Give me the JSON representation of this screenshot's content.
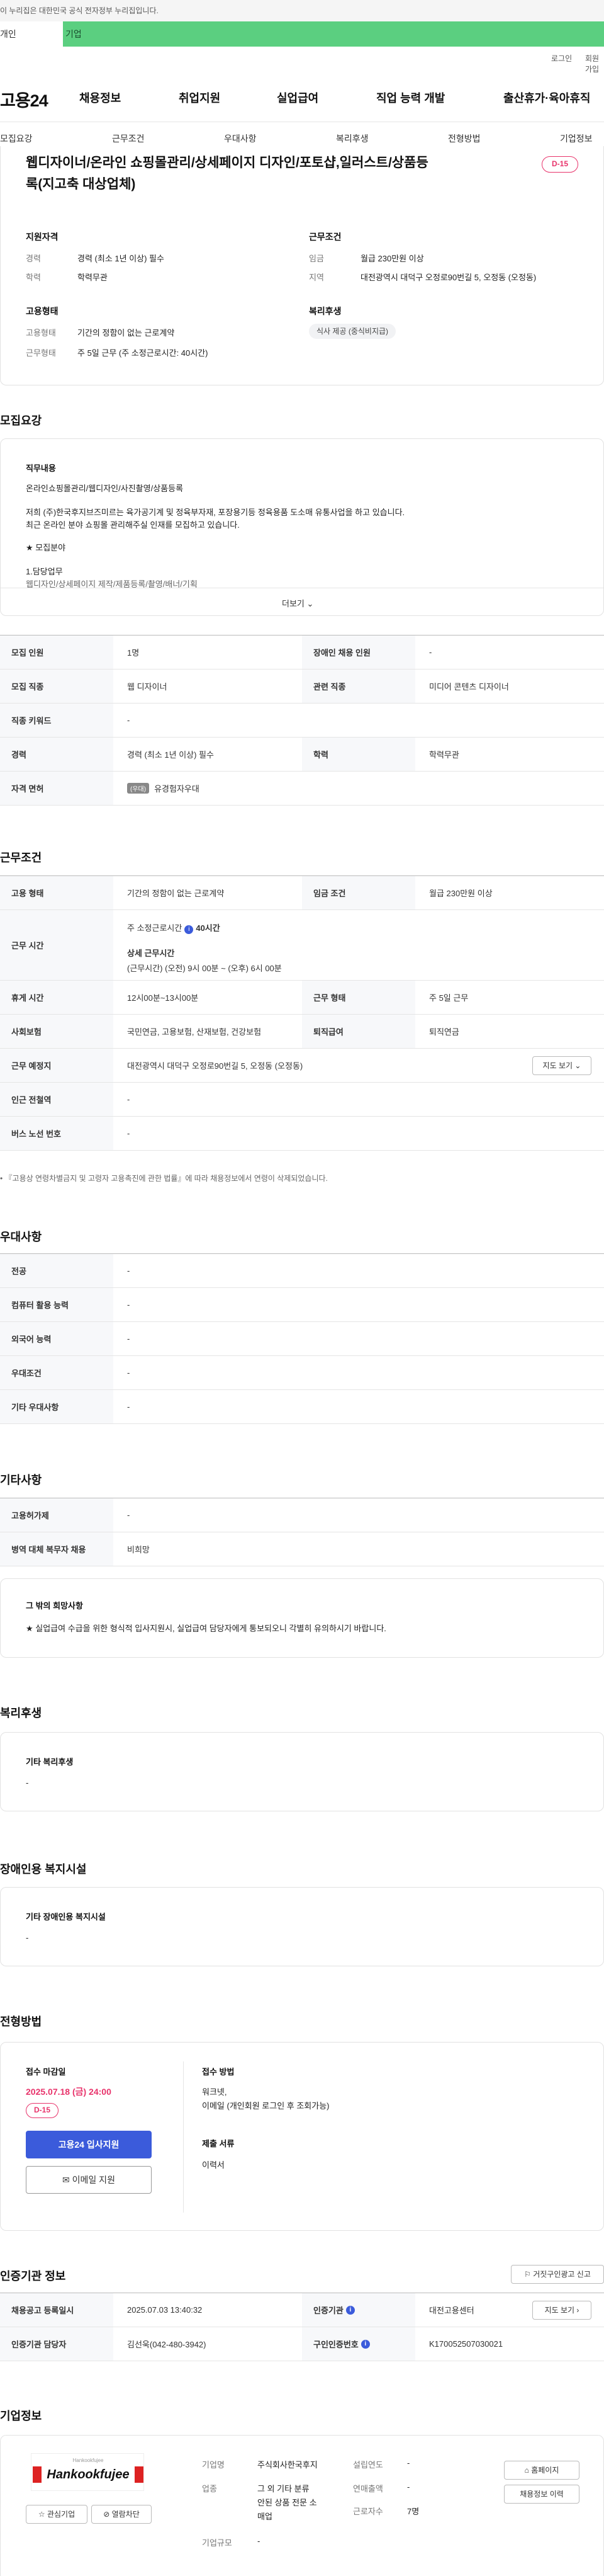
{
  "gov_banner": "이 누리집은 대한민국 공식 전자정부 누리집입니다.",
  "user_tabs": [
    "개인",
    "기업"
  ],
  "util": {
    "login": "로그인",
    "join": "회원가입"
  },
  "logo": "고용24",
  "gnb": [
    "채용정보",
    "취업지원",
    "실업급여",
    "직업 능력 개발",
    "출산휴가·육아휴직"
  ],
  "subnav": [
    "모집요강",
    "근무조건",
    "우대사항",
    "복리후생",
    "전형방법",
    "기업정보"
  ],
  "summary": {
    "title_line1": "웹디자이너/온라인 쇼핑몰관리/상세페이지 디자인/포토샵,일러스트/상품등",
    "title_line2": "록(지고축 대상업체)",
    "dday": "D-15",
    "qual_title": "지원자격",
    "qual": [
      {
        "k": "경력",
        "v": "경력 (최소 1년 이상) 필수"
      },
      {
        "k": "학력",
        "v": "학력무관"
      }
    ],
    "cond_title": "근무조건",
    "cond": [
      {
        "k": "임금",
        "v": "월급 230만원 이상"
      },
      {
        "k": "지역",
        "v": "대전광역시 대덕구 오정로90번길 5, 오정동 (오정동)"
      }
    ],
    "emp_title": "고용형태",
    "emp": [
      {
        "k": "고용형태",
        "v": "기간의 정함이 없는 근로계약"
      },
      {
        "k": "근무형태",
        "v": "주 5일 근무 (주 소정근로시간: 40시간)"
      }
    ],
    "welfare_title": "복리후생",
    "welfare_chip": "식사 제공 (중식비지급)"
  },
  "recruit": {
    "title": "모집요강",
    "duty_title": "직무내용",
    "duty_line1": "온라인쇼핑몰관리/웹디자인/사진촬영/상품등록",
    "duty_line2": "저희 (주)한국후지브즈미르는 육가공기계 및 정육부자재, 포장용기등 정육용품 도소매 유통사업을 하고 있습니다.",
    "duty_line3": "최근 온라인 분야  쇼핑몰 관리해주실 인재를 모집하고 있습니다.",
    "duty_line4": "★ 모집분야",
    "duty_line5": "1.담당업무",
    "duty_line6": "웹디자인/상세페이지 제작/제품등록/촬영/배너/기획",
    "more": "더보기",
    "rows": [
      {
        "k1": "모집 인원",
        "v1": "1명",
        "k2": "장애인 채용 인원",
        "v2": "-"
      },
      {
        "k1": "모집 직종",
        "v1": "웹 디자이너",
        "k2": "관련 직종",
        "v2": "미디어 콘텐츠 디자이너"
      },
      {
        "k1": "직종 키워드",
        "v1": "-"
      },
      {
        "k1": "경력",
        "v1": "경력 (최소 1년 이상) 필수",
        "k2": "학력",
        "v2": "학력무관"
      },
      {
        "k1": "자격 면허",
        "tag": "(우대)",
        "v1": "유경험자우대"
      }
    ]
  },
  "work": {
    "title": "근무조건",
    "r1": {
      "k1": "고용 형태",
      "v1": "기간의 정함이 없는 근로계약",
      "k2": "임금 조건",
      "v2": "월급 230만원 이상"
    },
    "r2": {
      "k": "근무 시간",
      "hours": "주 소정근로시간",
      "hours_v": "40시간",
      "detail_title": "상세 근무시간",
      "detail": "(근무시간) (오전) 9시 00분 ~ (오후) 6시 00분"
    },
    "r3": {
      "k1": "휴게 시간",
      "v1": "12시00분~13시00분",
      "k2": "근무 형태",
      "v2": "주 5일 근무"
    },
    "r4": {
      "k1": "사회보험",
      "v1": "국민연금, 고용보험, 산재보험, 건강보험",
      "k2": "퇴직급여",
      "v2": "퇴직연금"
    },
    "r5": {
      "k": "근무 예정지",
      "v": "대전광역시 대덕구 오정로90번길 5, 오정동 (오정동)",
      "btn": "지도 보기"
    },
    "r6": {
      "k": "인근 전철역",
      "v": "-"
    },
    "r7": {
      "k": "버스 노선 번호",
      "v": "-"
    },
    "note": "• 『고용상 연령차별금지 및 고령자 고용촉진에 관한 법률』에 따라 채용정보에서 연령이 삭제되었습니다."
  },
  "prefer": {
    "title": "우대사항",
    "rows": [
      {
        "k": "전공",
        "v": "-"
      },
      {
        "k": "컴퓨터 활용 능력",
        "v": "-"
      },
      {
        "k": "외국어 능력",
        "v": "-"
      },
      {
        "k": "우대조건",
        "v": "-"
      },
      {
        "k": "기타 우대사항",
        "v": "-"
      }
    ]
  },
  "etc": {
    "title": "기타사항",
    "rows": [
      {
        "k": "고용허가제",
        "v": "-"
      },
      {
        "k": "병역 대체 복무자 채용",
        "v": "비희망"
      }
    ],
    "box_title": "그 밖의 희망사항",
    "box_text": "★ 실업급여 수급을 위한 형식적 입사지원시, 실업급여 담당자에게 통보되오니 각별히 유의하시기 바랍니다."
  },
  "welfare": {
    "title": "복리후생",
    "box_title": "기타 복리후생",
    "box_v": "-"
  },
  "disabled": {
    "title": "장애인용 복지시설",
    "box_title": "기타 장애인용 복지시설",
    "box_v": "-"
  },
  "process": {
    "title": "전형방법",
    "deadline_label": "접수 마감일",
    "deadline": "2025.07.18 (금) 24:00",
    "dday": "D-15",
    "apply_btn": "고용24 입사지원",
    "email_btn": "이메일 지원",
    "method_label": "접수 방법",
    "method_1": "워크넷,",
    "method_2": "이메일 (개인회원 로그인 후 조회가능)",
    "docs_label": "제출 서류",
    "docs": "이력서"
  },
  "agency": {
    "title": "인증기관 정보",
    "report_btn": "거짓구인광고 신고",
    "r1": {
      "k1": "채용공고 등록일시",
      "v1": "2025.07.03 13:40:32",
      "k2": "인증기관",
      "v2": "대전고용센터",
      "btn": "지도 보기"
    },
    "r2": {
      "k1": "인증기관 담당자",
      "v1": "김선욱(042-480-3942)",
      "k2": "구인인증번호",
      "v2": "K170052507030021"
    }
  },
  "company": {
    "title": "기업정보",
    "logo_top": "Hankookfujee",
    "logo_main": "Hankookfujee",
    "fav_btn": "관심기업",
    "block_btn": "열람차단",
    "k_name": "기업명",
    "v_name": "주식회사한국후지",
    "k_biz": "업종",
    "v_biz1": "그 외 기타 분류",
    "v_biz2": "안된 상품 전문 소",
    "v_biz3": "매업",
    "k_scale": "기업규모",
    "v_scale": "-",
    "k_year": "설립연도",
    "v_year": "-",
    "k_sales": "연매출액",
    "v_sales": "-",
    "k_emp": "근로자수",
    "v_emp": "7명",
    "home_btn": "홈페이지",
    "jobs_btn": "채용정보 이력"
  }
}
